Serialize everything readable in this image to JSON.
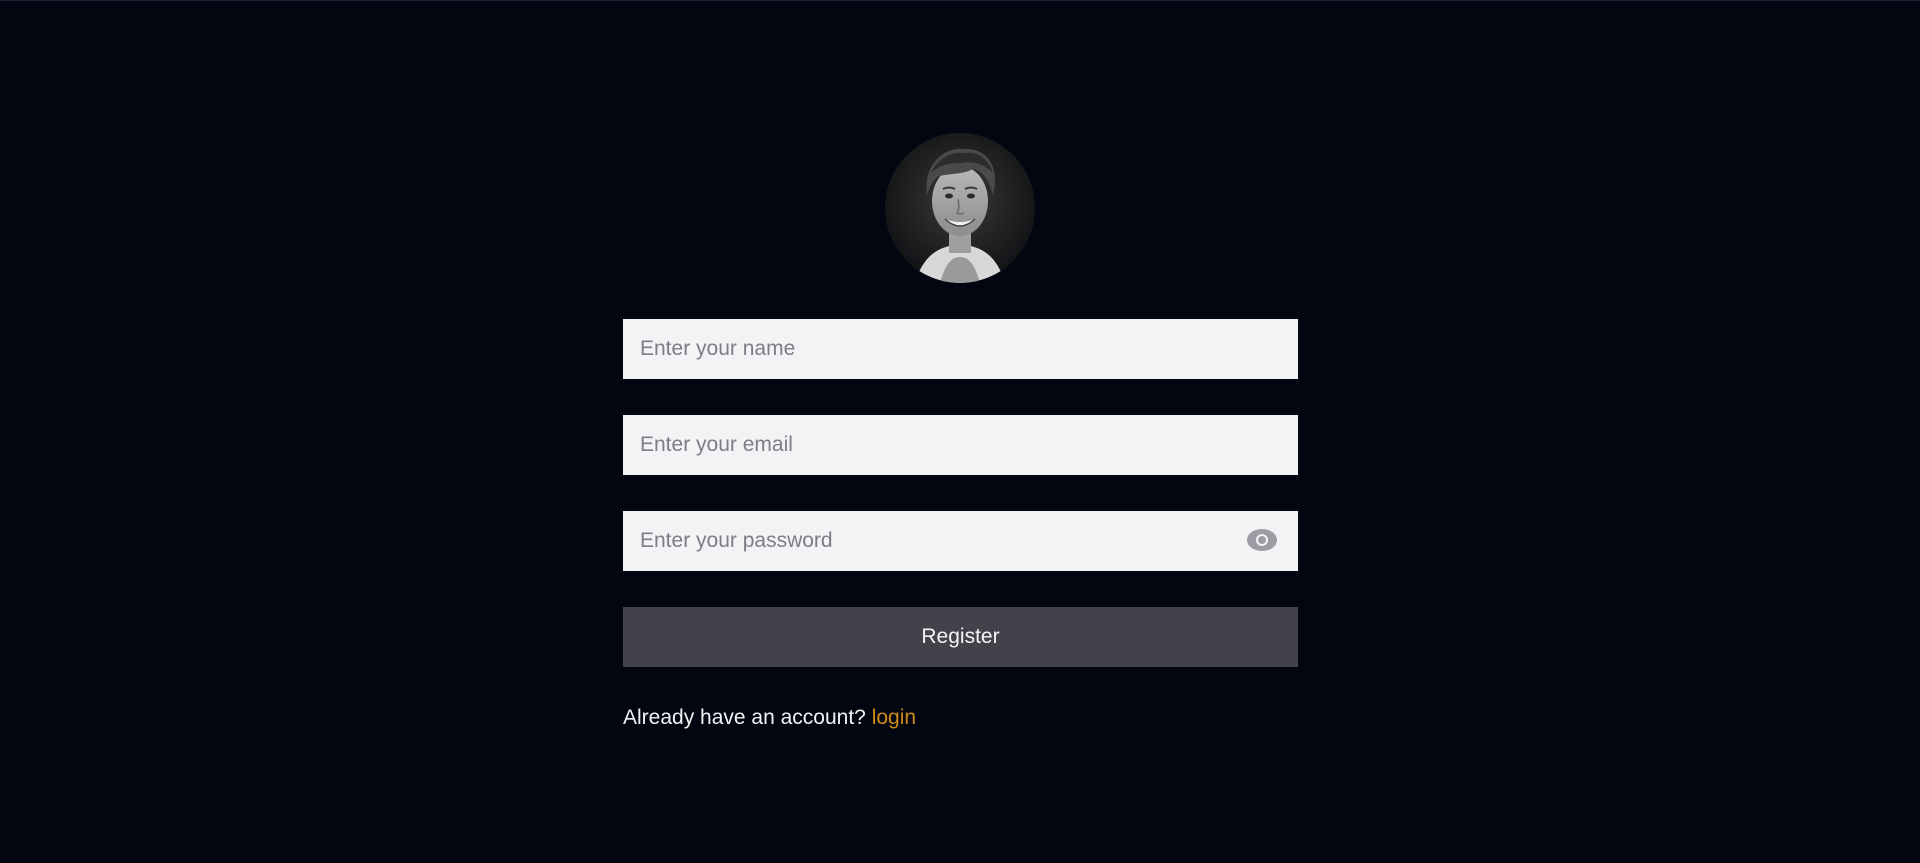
{
  "avatar": {
    "alt": "profile photo"
  },
  "form": {
    "name_placeholder": "Enter your name",
    "email_placeholder": "Enter your email",
    "password_placeholder": "Enter your password",
    "submit_label": "Register"
  },
  "footer": {
    "prompt": "Already have an account?",
    "link_label": "login"
  },
  "colors": {
    "page_background": "#020610",
    "input_background": "#f3f3f5",
    "button_background": "#42424b",
    "link": "#d08a1b"
  },
  "icons": {
    "password_toggle": "eye-icon"
  }
}
